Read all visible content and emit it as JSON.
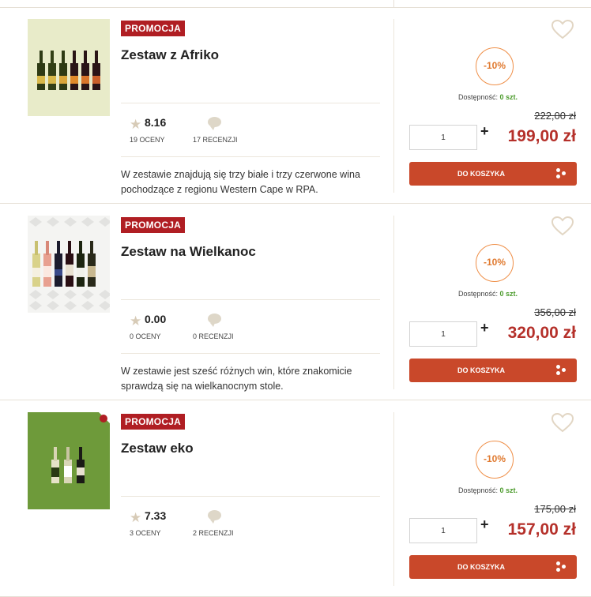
{
  "products": [
    {
      "badge": "PROMOCJA",
      "title": "Zestaw z Afriko",
      "rating": "8.16",
      "ratings_count": "19 OCENY",
      "reviews_count": "17 RECENZJI",
      "description": "W zestawie znajdują się trzy białe i trzy czerwone wina pochodzące z regionu Western Cape w RPA.",
      "discount": "-10%",
      "availability_label": "Dostępność:",
      "availability_value": "0 szt.",
      "old_price": "222,00 zł",
      "price": "199,00 zł",
      "quantity": "1",
      "plus": "+",
      "cart_label": "DO KOSZYKA"
    },
    {
      "badge": "PROMOCJA",
      "title": "Zestaw na Wielkanoc",
      "rating": "0.00",
      "ratings_count": "0 OCENY",
      "reviews_count": "0 RECENZJI",
      "description": "W zestawie jest sześć różnych win, które znakomicie sprawdzą się na wielkanocnym stole.",
      "discount": "-10%",
      "availability_label": "Dostępność:",
      "availability_value": "0 szt.",
      "old_price": "356,00 zł",
      "price": "320,00 zł",
      "quantity": "1",
      "plus": "+",
      "cart_label": "DO KOSZYKA"
    },
    {
      "badge": "PROMOCJA",
      "title": "Zestaw eko",
      "rating": "7.33",
      "ratings_count": "3 OCENY",
      "reviews_count": "2 RECENZJI",
      "description": "",
      "discount": "-10%",
      "availability_label": "Dostępność:",
      "availability_value": "0 szt.",
      "old_price": "175,00 zł",
      "price": "157,00 zł",
      "quantity": "1",
      "plus": "+",
      "cart_label": "DO KOSZYKA"
    }
  ],
  "colors": {
    "badge": "#b01e23",
    "price": "#b5302a",
    "discount_ring": "#ef8f48",
    "stock": "#4a9a2a",
    "cart_button": "#c9482a"
  },
  "icons": [
    "star-icon",
    "comment-icon",
    "heart-icon",
    "cart-dots-icon"
  ]
}
